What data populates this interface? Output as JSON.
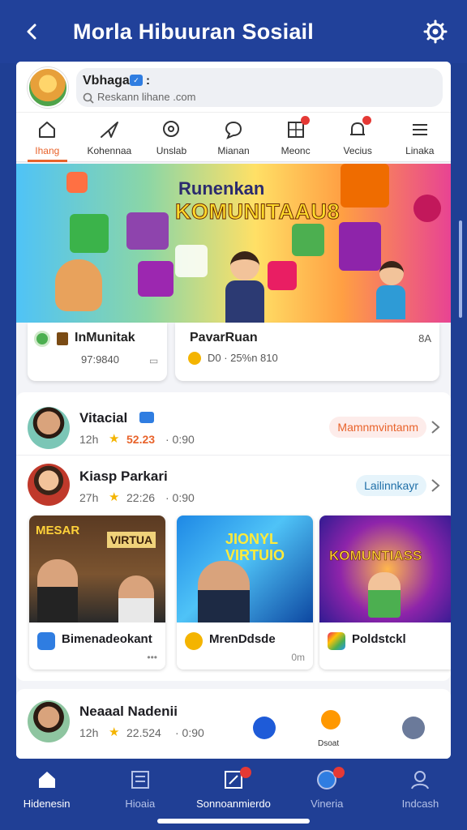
{
  "header": {
    "title": "Morla Hibuuran Sosiail"
  },
  "profile": {
    "name": "Vbhaga",
    "search_placeholder": "Reskann lihane .com"
  },
  "tabs": [
    {
      "label": "Ihang",
      "icon": "home-icon"
    },
    {
      "label": "Kohennaa",
      "icon": "send-icon"
    },
    {
      "label": "Unslab",
      "icon": "location-icon"
    },
    {
      "label": "Mianan",
      "icon": "chat-bubble-icon"
    },
    {
      "label": "Meonc",
      "icon": "grid-icon"
    },
    {
      "label": "Vecius",
      "icon": "bell-icon"
    },
    {
      "label": "Linaka",
      "icon": "menu-icon"
    }
  ],
  "banner": {
    "line1": "Runenkan",
    "line2": "KOMUNITAAU8"
  },
  "mini_cards": [
    {
      "title": "InMunitak",
      "sub": "97:9840"
    },
    {
      "title": "PavarRuan",
      "sub": "D0  · 25%n 810",
      "corner": "8A"
    }
  ],
  "rows": [
    {
      "name": "Vitacial",
      "time": "12h",
      "score": "52.23",
      "extra": "· 0:90",
      "pill": "Mamnmvintanm"
    },
    {
      "name": "Kiasp Parkari",
      "time": "27h",
      "score": "22:26",
      "extra": "· 0:90",
      "pill": "Lailinnkayr"
    }
  ],
  "thumbs": [
    {
      "caption": "Bimenadeokant",
      "headline": "VIRTUA",
      "tag": "MESAR",
      "foot": "•••"
    },
    {
      "caption": "MrenDdsde",
      "headline": "JIONYL VIRTUIO",
      "foot": "0m"
    },
    {
      "caption": "Poldstckl",
      "headline": "KOMUNTIASS",
      "foot": ""
    }
  ],
  "last_row": {
    "name": "Neaaal Nadenii",
    "time": "12h",
    "score": "22.524",
    "extra": "· 0:90",
    "fab_label": "Dsoat"
  },
  "bottom_nav": [
    {
      "label": "Hidenesin",
      "icon": "home-icon"
    },
    {
      "label": "Hioaia",
      "icon": "news-icon"
    },
    {
      "label": "Sonnoanmierdo",
      "icon": "compose-icon"
    },
    {
      "label": "Vineria",
      "icon": "globe-icon"
    },
    {
      "label": "Indcash",
      "icon": "person-icon"
    }
  ],
  "colors": {
    "primary": "#21419a",
    "accent": "#e8632b",
    "badge": "#e53935"
  }
}
